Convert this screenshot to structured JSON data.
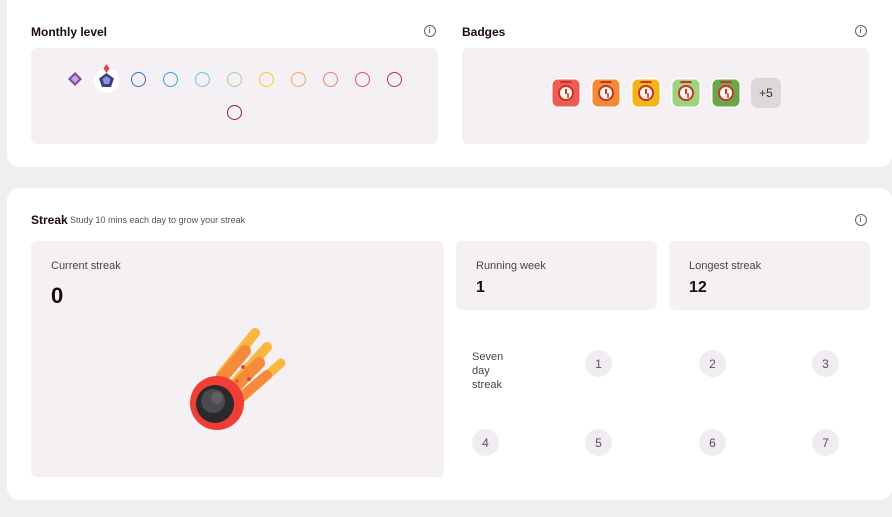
{
  "monthly_level": {
    "title": "Monthly level",
    "icons": [
      "purple-diamond-icon",
      "pentagon-gem-icon"
    ],
    "rings": [
      {
        "color": "#2d72c4"
      },
      {
        "color": "#2aa7d6"
      },
      {
        "color": "#6bc2ef"
      },
      {
        "color": "#9fd38b"
      },
      {
        "color": "#f6c82d"
      },
      {
        "color": "#f4a25a"
      },
      {
        "color": "#ee7c6b"
      },
      {
        "color": "#e0515a"
      },
      {
        "color": "#b8343f"
      },
      {
        "color": "#9e1d35"
      }
    ]
  },
  "badges": {
    "title": "Badges",
    "items": [
      {
        "name": "alarm-clock-badge-red",
        "color": "#ef5d52"
      },
      {
        "name": "alarm-clock-badge-orange",
        "color": "#f48a35"
      },
      {
        "name": "alarm-clock-badge-yellow",
        "color": "#f2b417"
      },
      {
        "name": "alarm-clock-badge-lightgreen",
        "color": "#9ed27d"
      },
      {
        "name": "alarm-clock-badge-green",
        "color": "#6aa64a"
      }
    ],
    "more_label": "+5"
  },
  "streak": {
    "title": "Streak",
    "subtitle": "Study 10 mins each day to grow your streak",
    "current": {
      "label": "Current streak",
      "value": "0"
    },
    "running_week": {
      "label": "Running week",
      "value": "1"
    },
    "longest": {
      "label": "Longest streak",
      "value": "12"
    },
    "seven_day": {
      "label_lines": [
        "Seven",
        "day",
        "streak"
      ],
      "days": [
        "1",
        "2",
        "3",
        "4",
        "5",
        "6",
        "7"
      ]
    }
  }
}
